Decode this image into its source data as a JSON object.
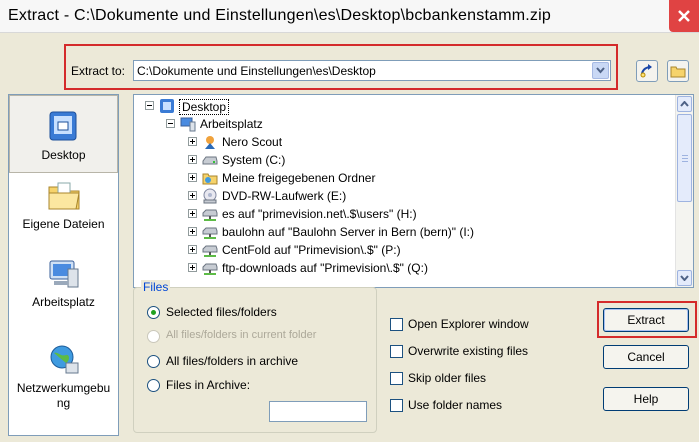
{
  "window": {
    "title": "Extract - C:\\Dokumente und Einstellungen\\es\\Desktop\\bcbankenstamm.zip"
  },
  "extract_to": {
    "label": "Extract to:",
    "value": "C:\\Dokumente und Einstellungen\\es\\Desktop"
  },
  "places": [
    {
      "label": "Desktop"
    },
    {
      "label": "Eigene Dateien"
    },
    {
      "label": "Arbeitsplatz"
    },
    {
      "label": "Netzwerkumgebu ng"
    }
  ],
  "tree": [
    {
      "label": "Desktop",
      "icon": "desktop-icon"
    },
    {
      "label": "Arbeitsplatz",
      "icon": "computer-icon"
    },
    {
      "label": "Nero Scout",
      "icon": "nero-scout-icon"
    },
    {
      "label": "System (C:)",
      "icon": "hard-drive-icon"
    },
    {
      "label": "Meine freigegebenen Ordner",
      "icon": "shared-folder-icon"
    },
    {
      "label": "DVD-RW-Laufwerk (E:)",
      "icon": "dvd-drive-icon"
    },
    {
      "label": "es auf \"primevision.net\\.$\\users\" (H:)",
      "icon": "network-drive-icon"
    },
    {
      "label": "baulohn auf \"Baulohn Server in Bern (bern)\" (I:)",
      "icon": "network-drive-icon"
    },
    {
      "label": "CentFold auf \"Primevision\\.$\" (P:)",
      "icon": "network-drive-icon"
    },
    {
      "label": "ftp-downloads auf \"Primevision\\.$\" (Q:)",
      "icon": "network-drive-icon"
    }
  ],
  "files_group": {
    "title": "Files",
    "options": [
      {
        "label": "Selected files/folders",
        "checked": true,
        "enabled": true
      },
      {
        "label": "All files/folders in current folder",
        "checked": false,
        "enabled": false
      },
      {
        "label": "All files/folders in archive",
        "checked": false,
        "enabled": true
      },
      {
        "label": "Files in Archive:",
        "checked": false,
        "enabled": true
      }
    ],
    "files_in_archive_value": ""
  },
  "checkboxes": [
    {
      "label": "Open Explorer window",
      "checked": false
    },
    {
      "label": "Overwrite existing files",
      "checked": false
    },
    {
      "label": "Skip older files",
      "checked": false
    },
    {
      "label": "Use folder names",
      "checked": false
    }
  ],
  "buttons": {
    "extract": "Extract",
    "cancel": "Cancel",
    "help": "Help"
  },
  "colors": {
    "highlight_box": "#d42b2b",
    "close_button": "#e04343",
    "group_title": "#0046d5"
  }
}
